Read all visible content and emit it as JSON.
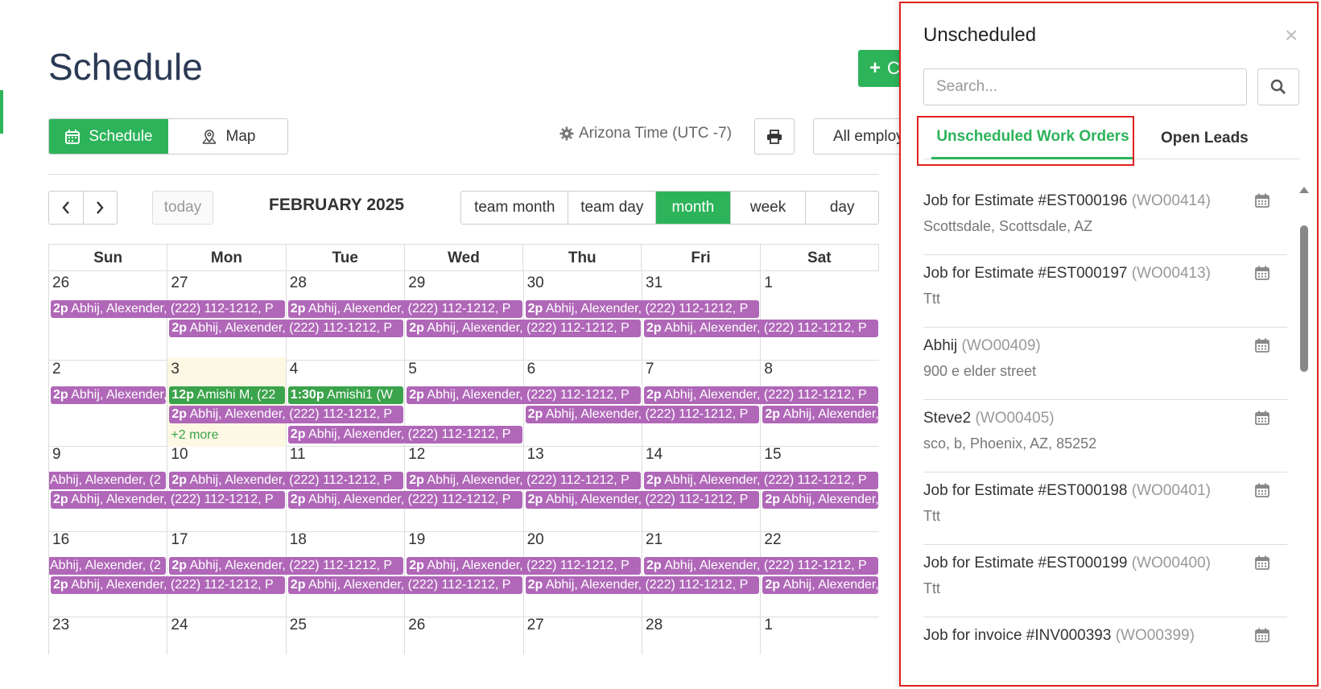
{
  "page": {
    "title": "Schedule"
  },
  "toolbar": {
    "create_label": "C",
    "view_schedule": "Schedule",
    "view_map": "Map",
    "timezone": "Arizona Time (UTC -7)",
    "employees_select": "All employ"
  },
  "calendar": {
    "today_label": "today",
    "month_title": "FEBRUARY 2025",
    "prev_icon": "chevron-left-icon",
    "next_icon": "chevron-right-icon",
    "ranges": [
      "team month",
      "team day",
      "month",
      "week",
      "day"
    ],
    "active_range": "month",
    "weekdays": [
      "Sun",
      "Mon",
      "Tue",
      "Wed",
      "Thu",
      "Fri",
      "Sat"
    ],
    "weeks": [
      {
        "days": [
          "26",
          "27",
          "28",
          "29",
          "30",
          "31",
          "1"
        ]
      },
      {
        "days": [
          "2",
          "3",
          "4",
          "5",
          "6",
          "7",
          "8"
        ]
      },
      {
        "days": [
          "9",
          "10",
          "11",
          "12",
          "13",
          "14",
          "15"
        ]
      },
      {
        "days": [
          "16",
          "17",
          "18",
          "19",
          "20",
          "21",
          "22"
        ]
      },
      {
        "days": [
          "23",
          "24",
          "25",
          "26",
          "27",
          "28",
          "1"
        ]
      }
    ],
    "event_time": "2p",
    "event_text": "Abhij, Alexender, (222) 112-1212, P",
    "event_text_cont": "Abhij, Alexender, (2",
    "green_event_1_time": "12p",
    "green_event_1_text": "Amishi M, (22",
    "green_event_2_time": "1:30p",
    "green_event_2_text": "Amishi1 (W",
    "more_label": "+2 more",
    "colors": {
      "accent": "#2db35a",
      "event": "#b067b8",
      "event_green": "#3ba34b",
      "today_bg": "#fcf8e3"
    }
  },
  "panel": {
    "title": "Unscheduled",
    "close_icon": "close-icon",
    "search_placeholder": "Search...",
    "tabs": [
      "Unscheduled Work Orders",
      "Open Leads"
    ],
    "items": [
      {
        "title": "Job for Estimate #EST000196",
        "code": "(WO00414)",
        "address": "Scottsdale, Scottsdale, AZ"
      },
      {
        "title": "Job for Estimate #EST000197",
        "code": "(WO00413)",
        "address": "Ttt"
      },
      {
        "title": "Abhij",
        "code": "(WO00409)",
        "address": "900 e elder street"
      },
      {
        "title": "Steve2",
        "code": "(WO00405)",
        "address": "sco, b, Phoenix, AZ, 85252"
      },
      {
        "title": "Job for Estimate #EST000198",
        "code": "(WO00401)",
        "address": "Ttt"
      },
      {
        "title": "Job for Estimate #EST000199",
        "code": "(WO00400)",
        "address": "Ttt"
      },
      {
        "title": "Job for invoice #INV000393",
        "code": "(WO00399)",
        "address": ""
      }
    ]
  }
}
